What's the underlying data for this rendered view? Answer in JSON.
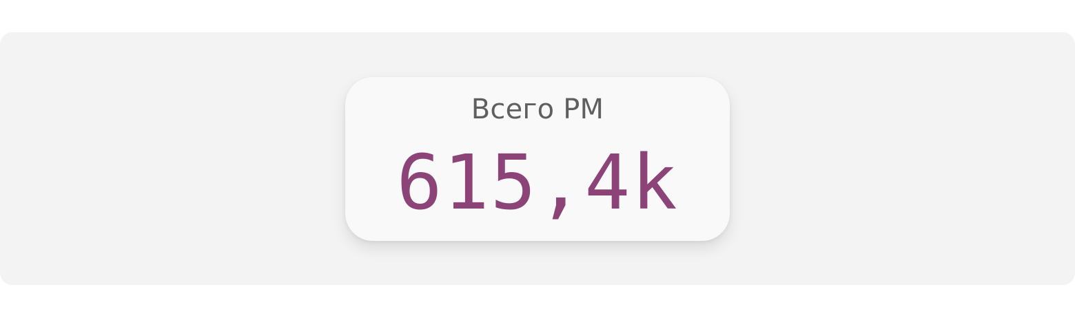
{
  "kpi": {
    "title": "Всего РМ",
    "value": "615,4k"
  },
  "colors": {
    "page_background": "#ffffff",
    "panel_background": "#f3f3f3",
    "card_background": "#f9f9f9",
    "title_text": "#5f5f5f",
    "value_text": "#8c4478"
  }
}
